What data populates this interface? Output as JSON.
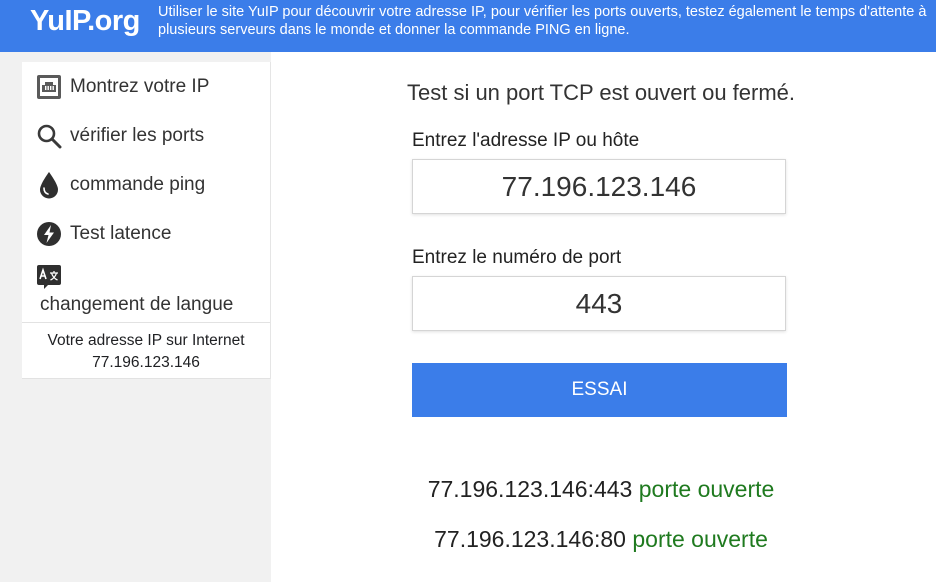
{
  "header": {
    "logo": "YuIP.org",
    "tagline": "Utiliser le site YuIP pour découvrir votre adresse IP, pour vérifier les ports ouverts, testez également le temps d'attente à plusieurs serveurs dans le monde et donner la commande PING en ligne.",
    "bg_color": "#3b7de9"
  },
  "sidebar": {
    "items": [
      {
        "label": "Montrez votre IP",
        "icon": "network-icon"
      },
      {
        "label": "vérifier les ports",
        "icon": "search-icon"
      },
      {
        "label": "commande ping",
        "icon": "drop-icon"
      },
      {
        "label": "Test latence",
        "icon": "lightning-icon"
      }
    ],
    "language": {
      "label": "changement de langue",
      "icon": "translate-icon"
    },
    "ip_box": {
      "title": "Votre adresse IP sur Internet",
      "ip": "77.196.123.146"
    }
  },
  "main": {
    "title": "Test si un port TCP est ouvert ou fermé.",
    "host_label": "Entrez l'adresse IP ou hôte",
    "host_value": "77.196.123.146",
    "port_label": "Entrez le numéro de port",
    "port_value": "443",
    "submit_label": "ESSAI",
    "results": [
      {
        "target": "77.196.123.146:443",
        "status": "porte ouverte"
      },
      {
        "target": "77.196.123.146:80",
        "status": "porte ouverte"
      }
    ],
    "status_color": "#1f7a1f"
  }
}
